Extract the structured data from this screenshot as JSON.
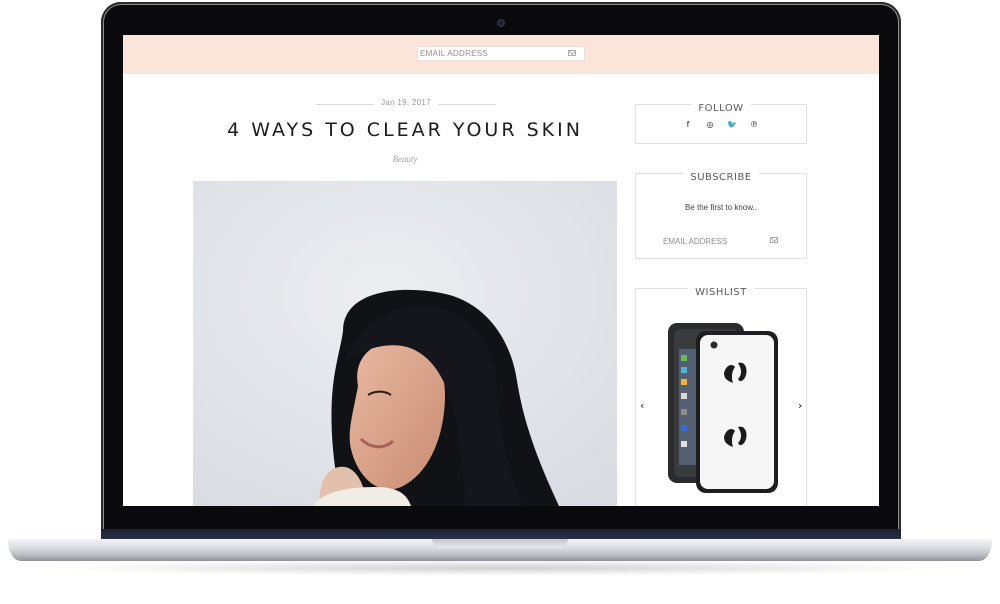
{
  "header": {
    "email_placeholder": "EMAIL ADDRESS",
    "mail_icon": "mail-icon"
  },
  "post": {
    "date": "Jan 19, 2017",
    "title": "4 WAYS TO CLEAR YOUR SKIN",
    "category": "Beauty"
  },
  "sidebar": {
    "follow": {
      "title": "FOLLOW",
      "icons": [
        "facebook-icon",
        "instagram-icon",
        "twitter-icon",
        "pinterest-icon"
      ],
      "glyphs": [
        "f",
        "◎",
        "🐦",
        "℗"
      ]
    },
    "subscribe": {
      "title": "SUBSCRIBE",
      "text": "Be the first to know..",
      "email_placeholder": "EMAIL ADDRESS"
    },
    "wishlist": {
      "title": "WISHLIST",
      "prev": "‹",
      "next": "›"
    }
  },
  "colors": {
    "header_bg": "#fbe5db",
    "text_dark": "#1d1d1d",
    "text_muted": "#9b9b9b"
  }
}
